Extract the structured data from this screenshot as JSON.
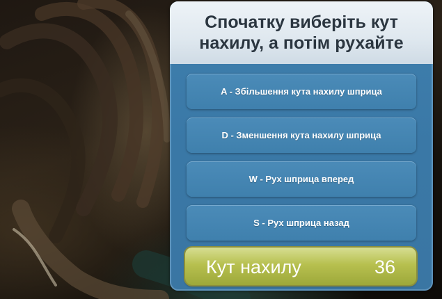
{
  "panel": {
    "title": "Спочатку виберіть кут нахилу, а потім рухайте",
    "options": [
      {
        "key": "A",
        "label": "A - Збільшення кута нахилу шприца"
      },
      {
        "key": "D",
        "label": "D - Зменшення кута нахилу шприца"
      },
      {
        "key": "W",
        "label": "W - Рух шприца вперед"
      },
      {
        "key": "S",
        "label": "S - Рух шприца назад"
      }
    ],
    "angle_label": "Кут нахилу",
    "angle_value": "36"
  },
  "colors": {
    "panel_blue": "#3a78a6",
    "header_light": "#e6edf3",
    "angle_green": "#b7c04f"
  }
}
